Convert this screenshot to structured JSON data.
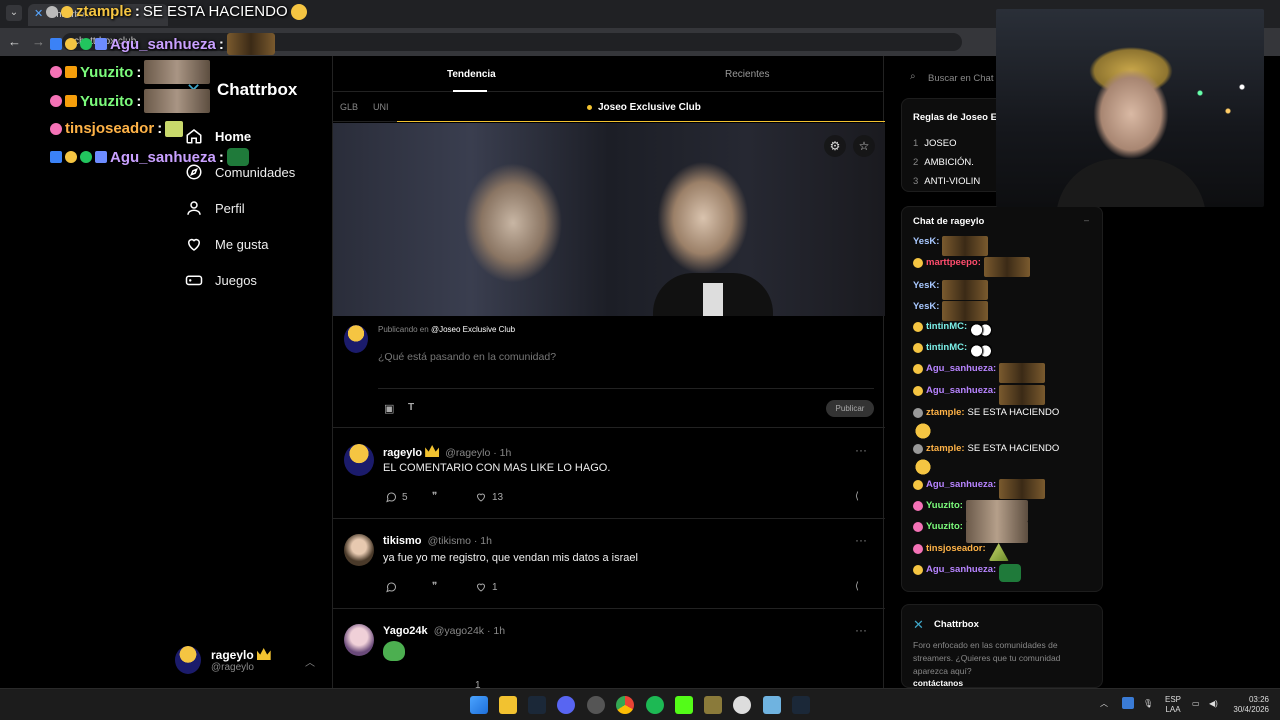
{
  "browser": {
    "tab_title": "Chattrbox",
    "url": "chattrbox.club"
  },
  "overlay": [
    {
      "name": "ztample",
      "message": "SE ESTA HACIENDO",
      "color": "#f5c542"
    },
    {
      "name": "Agu_sanhueza",
      "message": "",
      "color": "#c9a0ff"
    },
    {
      "name": "Yuuzito",
      "message": "",
      "color": "#7cfc7c"
    },
    {
      "name": "Yuuzito",
      "message": "",
      "color": "#7cfc7c"
    },
    {
      "name": "tinsjoseador",
      "message": "",
      "color": "#ffb347"
    },
    {
      "name": "Agu_sanhueza",
      "message": "",
      "color": "#c9a0ff"
    }
  ],
  "sidebar": {
    "brand": "Chattrbox",
    "items": [
      {
        "label": "Home",
        "icon": "home-icon"
      },
      {
        "label": "Comunidades",
        "icon": "compass-icon"
      },
      {
        "label": "Perfil",
        "icon": "user-icon"
      },
      {
        "label": "Me gusta",
        "icon": "heart-icon"
      },
      {
        "label": "Juegos",
        "icon": "gamepad-icon"
      }
    ],
    "user": {
      "name": "rageylo",
      "handle": "@rageylo"
    }
  },
  "feed": {
    "tabs": [
      "Tendencia",
      "Recientes"
    ],
    "subtabs": [
      "GLB",
      "UNI"
    ],
    "community": "Joseo Exclusive Club",
    "composer": {
      "publishing_prefix": "Publicando en",
      "publishing_target": "@Joseo Exclusive Club",
      "placeholder": "¿Qué está pasando en la comunidad?",
      "button": "Publicar"
    },
    "posts": [
      {
        "name": "rageylo",
        "handle": "@rageylo",
        "time": "1h",
        "text": "EL COMENTARIO CON MAS LIKE LO HAGO.",
        "comments": "5",
        "likes": "13"
      },
      {
        "name": "tikismo",
        "handle": "@tikismo",
        "time": "1h",
        "text": "ya fue yo me registro, que vendan mis datos a israel",
        "comments": "",
        "likes": "1"
      },
      {
        "name": "Yago24k",
        "handle": "@yago24k",
        "time": "1h",
        "text": "",
        "comments": "",
        "likes": "1"
      }
    ]
  },
  "right": {
    "search_placeholder": "Buscar en Chat",
    "rules": {
      "title": "Reglas de Joseo Ex",
      "items": [
        {
          "num": "1",
          "text": "JOSEO"
        },
        {
          "num": "2",
          "text": "AMBICIÓN."
        },
        {
          "num": "3",
          "text": "ANTI-VIOLIN"
        }
      ]
    },
    "chat": {
      "title": "Chat de rageylo",
      "minimize": "–",
      "lines": [
        {
          "name": "YesK:",
          "color": "#a8c8ff",
          "text": ""
        },
        {
          "name": "marttpeepo:",
          "color": "#ff4d6d",
          "text": ""
        },
        {
          "name": "YesK:",
          "color": "#a8c8ff",
          "text": ""
        },
        {
          "name": "YesK:",
          "color": "#a8c8ff",
          "text": ""
        },
        {
          "name": "tintinMC:",
          "color": "#7cf0e8",
          "text": ""
        },
        {
          "name": "tintinMC:",
          "color": "#7cf0e8",
          "text": ""
        },
        {
          "name": "Agu_sanhueza:",
          "color": "#b784ff",
          "text": ""
        },
        {
          "name": "Agu_sanhueza:",
          "color": "#b784ff",
          "text": ""
        },
        {
          "name": "ztample:",
          "color": "#ffb347",
          "text": "SE ESTA HACIENDO"
        },
        {
          "name": "ztample:",
          "color": "#ffb347",
          "text": "SE ESTA HACIENDO"
        },
        {
          "name": "Agu_sanhueza:",
          "color": "#b784ff",
          "text": ""
        },
        {
          "name": "Yuuzito:",
          "color": "#7cfc7c",
          "text": ""
        },
        {
          "name": "Yuuzito:",
          "color": "#7cfc7c",
          "text": ""
        },
        {
          "name": "tinsjoseador:",
          "color": "#ffb347",
          "text": ""
        },
        {
          "name": "Agu_sanhueza:",
          "color": "#b784ff",
          "text": ""
        }
      ]
    },
    "about": {
      "title": "Chattrbox",
      "description": "Foro enfocado en las comunidades de streamers. ¿Quieres que tu comunidad aparezca aquí?",
      "cta": "contáctanos"
    }
  },
  "taskbar": {
    "lang": "ESP",
    "layout": "LAA",
    "time": "03:26",
    "date": "30/4/2026"
  },
  "colors": {
    "accent": "#f2c230",
    "background": "#000000",
    "brand_blue": "#3fa6c8"
  }
}
